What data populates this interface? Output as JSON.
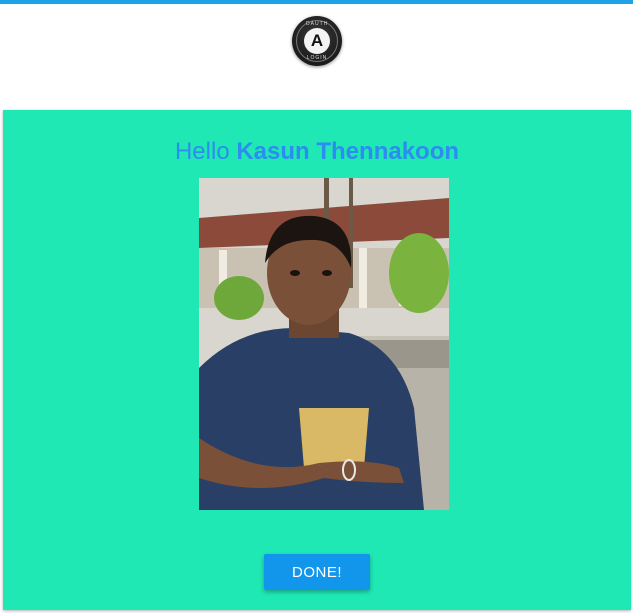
{
  "header": {
    "logo_icon": "oauth-logo-icon",
    "logo_letter": "A",
    "logo_text_top": "OAUTH",
    "logo_text_bottom": "LOGIN"
  },
  "card": {
    "greeting_prefix": "Hello",
    "user_name": "Kasun Thennakoon",
    "photo_alt": "Profile photo of Kasun Thennakoon",
    "done_label": "DONE!"
  },
  "colors": {
    "topbar": "#1fa3e6",
    "card_background": "#1fe8b4",
    "greeting_text": "#2d8cf0",
    "button_background": "#1196ec"
  }
}
